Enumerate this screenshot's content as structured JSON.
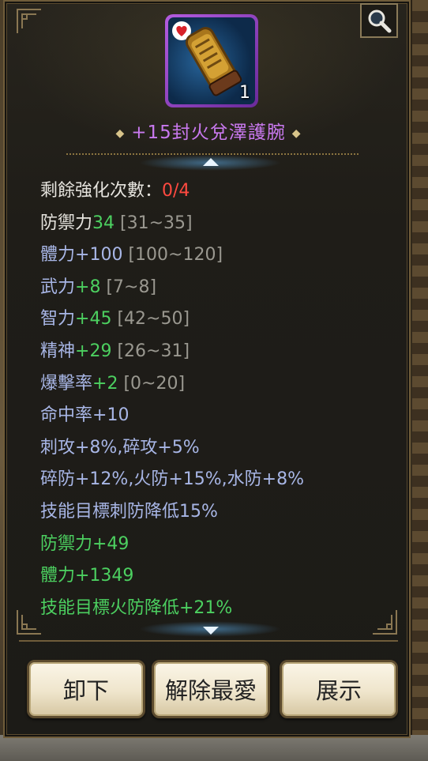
{
  "item": {
    "name": "+15封火兌澤護腕",
    "count": "1",
    "icon": "bracer-icon",
    "favorite_icon": "heart-icon"
  },
  "stats": [
    {
      "label": "剩餘強化次數：",
      "value": "0/4",
      "range": "",
      "label_color": "white",
      "value_color": "red"
    },
    {
      "label": "防禦力",
      "value": "34",
      "range": "[31~35]",
      "label_color": "white",
      "value_color": "green"
    },
    {
      "label": "體力",
      "value": "+100",
      "range": "[100~120]",
      "label_color": "blue",
      "value_color": "blue"
    },
    {
      "label": "武力",
      "value": "+8",
      "range": "[7~8]",
      "label_color": "blue",
      "value_color": "green"
    },
    {
      "label": "智力",
      "value": "+45",
      "range": "[42~50]",
      "label_color": "blue",
      "value_color": "green"
    },
    {
      "label": "精神",
      "value": "+29",
      "range": "[26~31]",
      "label_color": "blue",
      "value_color": "green"
    },
    {
      "label": "爆擊率",
      "value": "+2",
      "range": "[0~20]",
      "label_color": "blue",
      "value_color": "green"
    },
    {
      "label": "命中率",
      "value": "+10",
      "range": "",
      "label_color": "blue",
      "value_color": "blue"
    },
    {
      "label": "刺攻+8%,碎攻+5%",
      "value": "",
      "range": "",
      "label_color": "blue",
      "value_color": "blue"
    },
    {
      "label": "碎防+12%,火防+15%,水防+8%",
      "value": "",
      "range": "",
      "label_color": "blue",
      "value_color": "blue"
    },
    {
      "label": "技能目標刺防降低15%",
      "value": "",
      "range": "",
      "label_color": "blue",
      "value_color": "blue"
    },
    {
      "label": "防禦力+49",
      "value": "",
      "range": "",
      "label_color": "green",
      "value_color": "green"
    },
    {
      "label": "體力+1349",
      "value": "",
      "range": "",
      "label_color": "green",
      "value_color": "green"
    },
    {
      "label": "技能目標火防降低+21%",
      "value": "",
      "range": "",
      "label_color": "green",
      "value_color": "green"
    }
  ],
  "buttons": {
    "unequip": "卸下",
    "unfavorite": "解除最愛",
    "show": "展示"
  },
  "colors": {
    "item_name": "#c979ef",
    "white": "#e6e4de",
    "blue": "#a8b6e6",
    "green": "#4cd060",
    "red": "#ff4a40",
    "range": "#9a9890"
  },
  "icons": {
    "search": "magnifier-icon",
    "scroll_up": "arrow-up-icon",
    "scroll_down": "arrow-down-icon"
  }
}
